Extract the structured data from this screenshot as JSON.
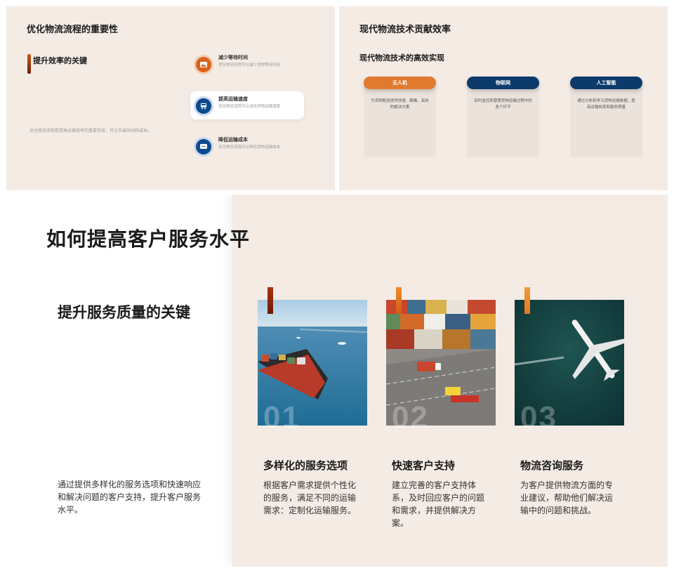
{
  "slide1": {
    "title": "优化物流流程的重要性",
    "subtitle": "提升效率的关键",
    "description": "优化物流流程是提高运输效率的重要手段，可以节省时间和成本。",
    "items": [
      {
        "title": "减少等待时间",
        "desc": "优化物流流程可以减少货物等待时间",
        "icon": "image-icon",
        "color": "#d9621c",
        "active": false
      },
      {
        "title": "提高运输速度",
        "desc": "优化物流流程可以加快货物运输速度",
        "icon": "truck-icon",
        "color": "#0d4a8f",
        "active": true
      },
      {
        "title": "降低运输成本",
        "desc": "优化物流流程可以降低货物运输成本",
        "icon": "chat-icon",
        "color": "#0d4a8f",
        "active": false
      }
    ]
  },
  "slide2": {
    "title": "现代物流技术贡献效率",
    "subtitle": "现代物流技术的高效实现",
    "cards": [
      {
        "label": "无人机",
        "desc": "为货物配送提供快速、精确、高效的解决方案",
        "color": "#e07a2e"
      },
      {
        "label": "物联网",
        "desc": "实时监控和管理货物运输过程中的各个环节",
        "color": "#0c3a6b"
      },
      {
        "label": "人工智能",
        "desc": "通过分析和学习货物运输数据，提高运输效率和服务质量",
        "color": "#0c3a6b"
      }
    ]
  },
  "slide3": {
    "title": "如何提高客户服务水平",
    "subtitle": "提升服务质量的关键",
    "description": "通过提供多样化的服务选项和快速响应和解决问题的客户支持，提升客户服务水平。",
    "services": [
      {
        "num": "01",
        "title": "多样化的服务选项",
        "desc": "根据客户需求提供个性化的服务，满足不同的运输需求：定制化运输服务。",
        "image": "cargo-ship-image",
        "tag_color": "#8a2a0c"
      },
      {
        "num": "02",
        "title": "快速客户支持",
        "desc": "建立完善的客户支持体系，及时回应客户的问题和需求，并提供解决方案。",
        "image": "container-port-image",
        "tag_color": "#e07a1e"
      },
      {
        "num": "03",
        "title": "物流咨询服务",
        "desc": "为客户提供物流方面的专业建议，帮助他们解决运输中的问题和挑战。",
        "image": "airplane-image",
        "tag_color": "#e88a2e"
      }
    ]
  }
}
